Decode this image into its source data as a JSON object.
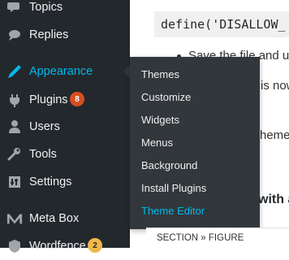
{
  "sidebar": {
    "items": [
      {
        "label": "Topics",
        "icon": "topics-icon"
      },
      {
        "label": "Replies",
        "icon": "replies-icon"
      },
      {
        "label": "Appearance",
        "icon": "appearance-icon",
        "active": true
      },
      {
        "label": "Plugins",
        "icon": "plugins-icon",
        "badge": "8"
      },
      {
        "label": "Users",
        "icon": "users-icon"
      },
      {
        "label": "Tools",
        "icon": "tools-icon"
      },
      {
        "label": "Settings",
        "icon": "settings-icon"
      },
      {
        "label": "Meta Box",
        "icon": "meta-box-logo"
      },
      {
        "label": "Wordfence",
        "icon": "wordfence-icon",
        "badge": "2"
      }
    ]
  },
  "submenu": {
    "items": [
      {
        "label": "Themes"
      },
      {
        "label": "Customize"
      },
      {
        "label": "Widgets"
      },
      {
        "label": "Menus"
      },
      {
        "label": "Background"
      },
      {
        "label": "Install Plugins"
      },
      {
        "label": "Theme Editor",
        "current": true
      }
    ]
  },
  "content": {
    "code": "define('DISALLOW_",
    "bullet1": "Save the file and u",
    "line2": "is now",
    "line3": "heme",
    "heading": "with a"
  },
  "breadcrumb": "SECTION » FIGURE",
  "colors": {
    "sidebar_bg": "#23282d",
    "submenu_bg": "#32373c",
    "accent": "#00b9eb",
    "badge": "#d54e21",
    "badge_warning": "#f0b849"
  }
}
